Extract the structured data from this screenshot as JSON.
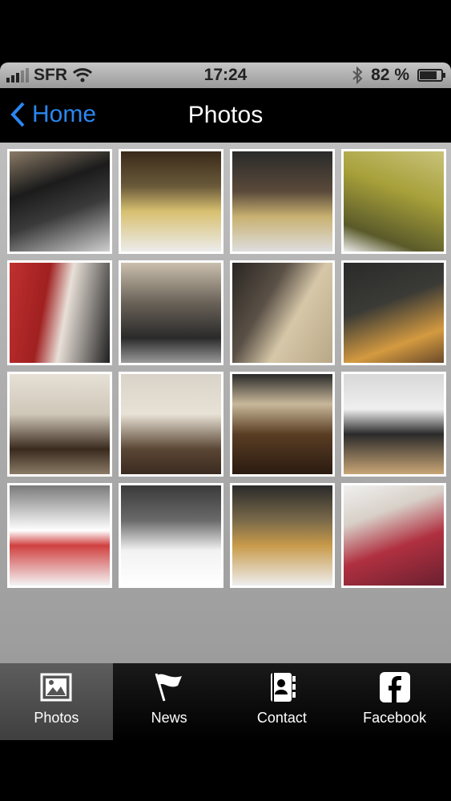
{
  "status_bar": {
    "carrier": "SFR",
    "time": "17:24",
    "battery": "82 %",
    "battery_level": 0.82
  },
  "nav": {
    "back_label": "Home",
    "title": "Photos"
  },
  "photos": [
    {
      "name": "storefront"
    },
    {
      "name": "deli-counter"
    },
    {
      "name": "bar-counter"
    },
    {
      "name": "food-display"
    },
    {
      "name": "chef"
    },
    {
      "name": "dining-hall"
    },
    {
      "name": "stone-wall-logo"
    },
    {
      "name": "bar-seating"
    },
    {
      "name": "wall-tables"
    },
    {
      "name": "banquette-room"
    },
    {
      "name": "lounge"
    },
    {
      "name": "kitchen-island"
    },
    {
      "name": "buffet-outdoor"
    },
    {
      "name": "buffet-terrace"
    },
    {
      "name": "canape-table"
    },
    {
      "name": "carpaccio-plate"
    }
  ],
  "tabs": [
    {
      "label": "Photos",
      "icon": "photo-icon",
      "active": true
    },
    {
      "label": "News",
      "icon": "flag-icon",
      "active": false
    },
    {
      "label": "Contact",
      "icon": "address-book-icon",
      "active": false
    },
    {
      "label": "Facebook",
      "icon": "facebook-icon",
      "active": false
    }
  ]
}
